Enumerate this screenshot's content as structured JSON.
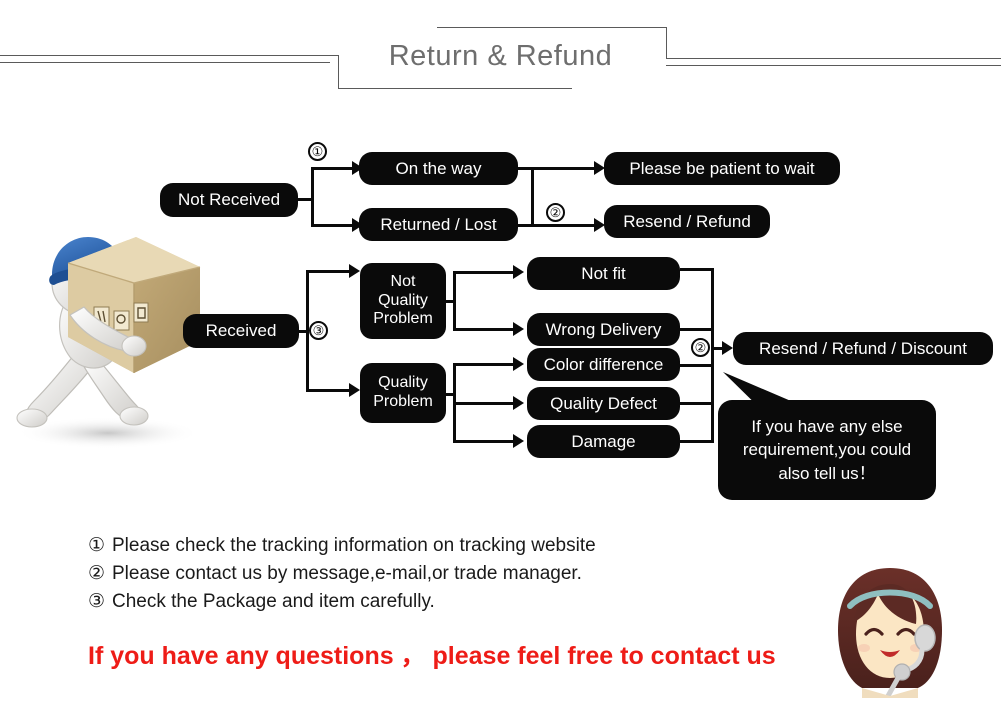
{
  "header": {
    "title": "Return & Refund"
  },
  "flow": {
    "not_received": "Not Received",
    "on_the_way": "On the way",
    "returned_lost": "Returned / Lost",
    "please_wait": "Please be patient to wait",
    "resend_refund": "Resend / Refund",
    "received": "Received",
    "not_quality_problem": "Not\nQuality\nProblem",
    "quality_problem": "Quality\nProblem",
    "not_fit": "Not fit",
    "wrong_delivery": "Wrong Delivery",
    "color_difference": "Color difference",
    "quality_defect": "Quality Defect",
    "damage": "Damage",
    "resend_refund_discount": "Resend / Refund / Discount",
    "bubble": "If you have any else\nrequirement,you could\nalso tell us！",
    "marker_1": "①",
    "marker_2a": "②",
    "marker_2b": "②",
    "marker_3": "③"
  },
  "notes": [
    {
      "bullet": "①",
      "text": "Please check the tracking information on tracking website"
    },
    {
      "bullet": "②",
      "text": "Please contact us by message,e-mail,or trade manager."
    },
    {
      "bullet": "③",
      "text": "Check the Package and item carefully."
    }
  ],
  "footer": {
    "cta": "If you have any questions ，  please feel free to contact us"
  },
  "icons": {
    "courier": "running-courier-with-box-icon",
    "agent": "customer-service-girl-icon"
  },
  "colors": {
    "box_fill": "#0a0a0a",
    "box_text": "#ffffff",
    "header_text": "#6e6e6e",
    "header_rule": "#5a5a5a",
    "cta_red": "#ee1c17",
    "note_text": "#1a1a1a",
    "cap_blue": "#2a63ae",
    "carton_tan": "#dcc79a",
    "hair_brown": "#5c2a24"
  }
}
